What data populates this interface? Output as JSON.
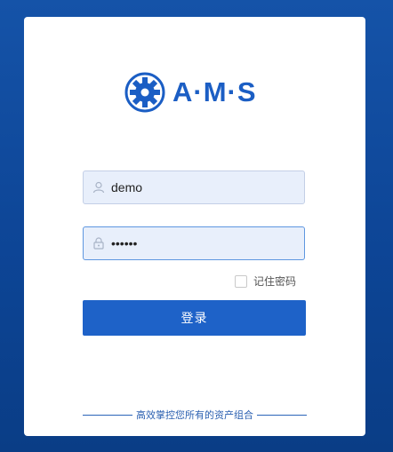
{
  "logo": {
    "text": "A·M·S",
    "icon": "gear-icon",
    "color": "#1b5ec4"
  },
  "form": {
    "username": {
      "value": "demo",
      "icon": "user-icon"
    },
    "password": {
      "value": "••••••",
      "icon": "lock-icon"
    },
    "remember_label": "记住密码",
    "remember_checked": false,
    "submit_label": "登录"
  },
  "tagline": "高效掌控您所有的资产组合",
  "colors": {
    "background": "#0d4596",
    "primary": "#1e62c8",
    "input_bg": "#e8effb"
  }
}
